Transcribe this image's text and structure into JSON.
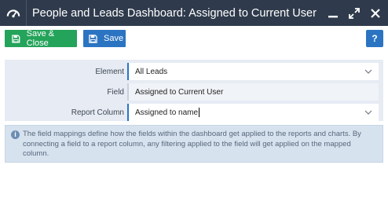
{
  "window": {
    "title": "People and Leads Dashboard: Assigned to Current User (F..."
  },
  "toolbar": {
    "save_close_label": "Save & Close",
    "save_label": "Save",
    "help_label": "?"
  },
  "form": {
    "element_label": "Element",
    "element_value": "All Leads",
    "field_label": "Field",
    "field_value": "Assigned to Current User",
    "report_column_label": "Report Column",
    "report_column_value": "Assigned to name"
  },
  "info": {
    "text": "The field mappings define how the fields within the dashboard get applied to the reports and charts. By connecting a field to a report column, any filtering applied to the field will get applied on the mapped column."
  },
  "colors": {
    "titlebar": "#2f3b4c",
    "save_close": "#24a35a",
    "save": "#2b74c2",
    "form_bg": "#e6ebf4",
    "info_bg": "#d7e2ef"
  }
}
